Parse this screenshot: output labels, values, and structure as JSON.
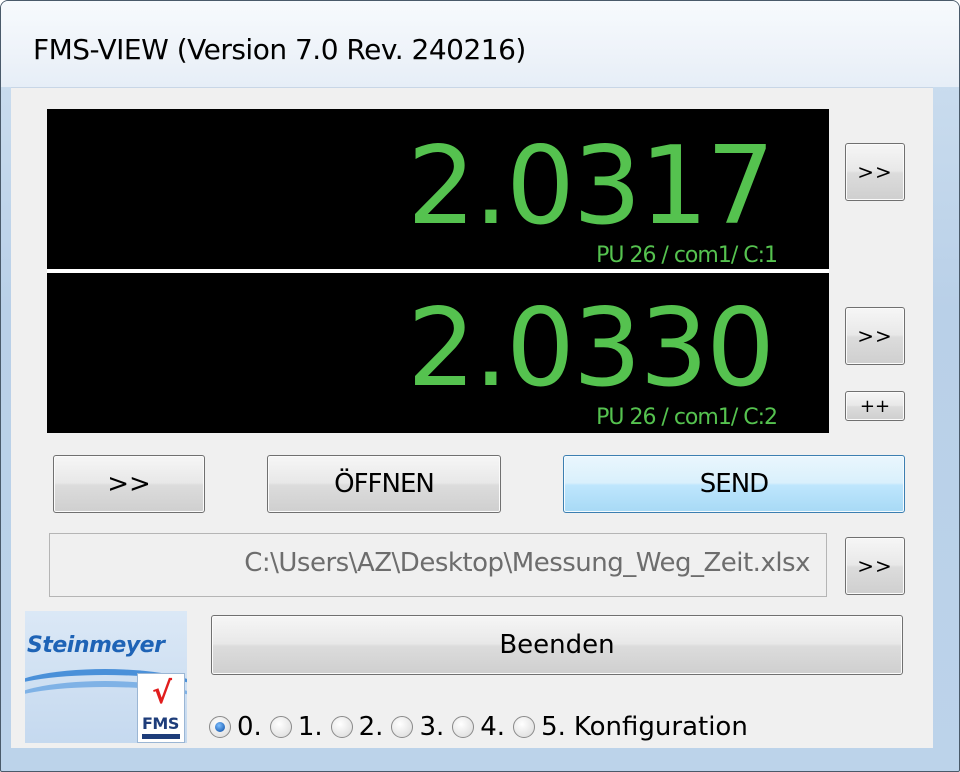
{
  "window": {
    "title": "FMS-VIEW (Version 7.0 Rev. 240216)"
  },
  "displays": [
    {
      "value": "2.0317",
      "label": "PU 26 / com1/ C:1",
      "side_button": ">>"
    },
    {
      "value": "2.0330",
      "label": "PU 26 / com1/ C:2",
      "side_button": ">>",
      "extra_button": "++"
    }
  ],
  "actions": {
    "arrow_label": ">>",
    "open_label": "ÖFFNEN",
    "send_label": "SEND"
  },
  "file": {
    "path": "C:\\Users\\AZ\\Desktop\\Messung_Weg_Zeit.xlsx",
    "browse_label": ">>"
  },
  "exit_label": "Beenden",
  "logo": {
    "brand": "Steinmeyer",
    "badge": "FMS",
    "check": "√"
  },
  "config": {
    "options": [
      "0.",
      "1.",
      "2.",
      "3.",
      "4.",
      "5."
    ],
    "selected_index": 0,
    "label": "Konfiguration"
  },
  "colors": {
    "display_bg": "#000000",
    "display_text": "#55c24f",
    "send_accent": "#3c7fb1",
    "logo_blue": "#1e63b6",
    "check_red": "#e11d1d"
  }
}
